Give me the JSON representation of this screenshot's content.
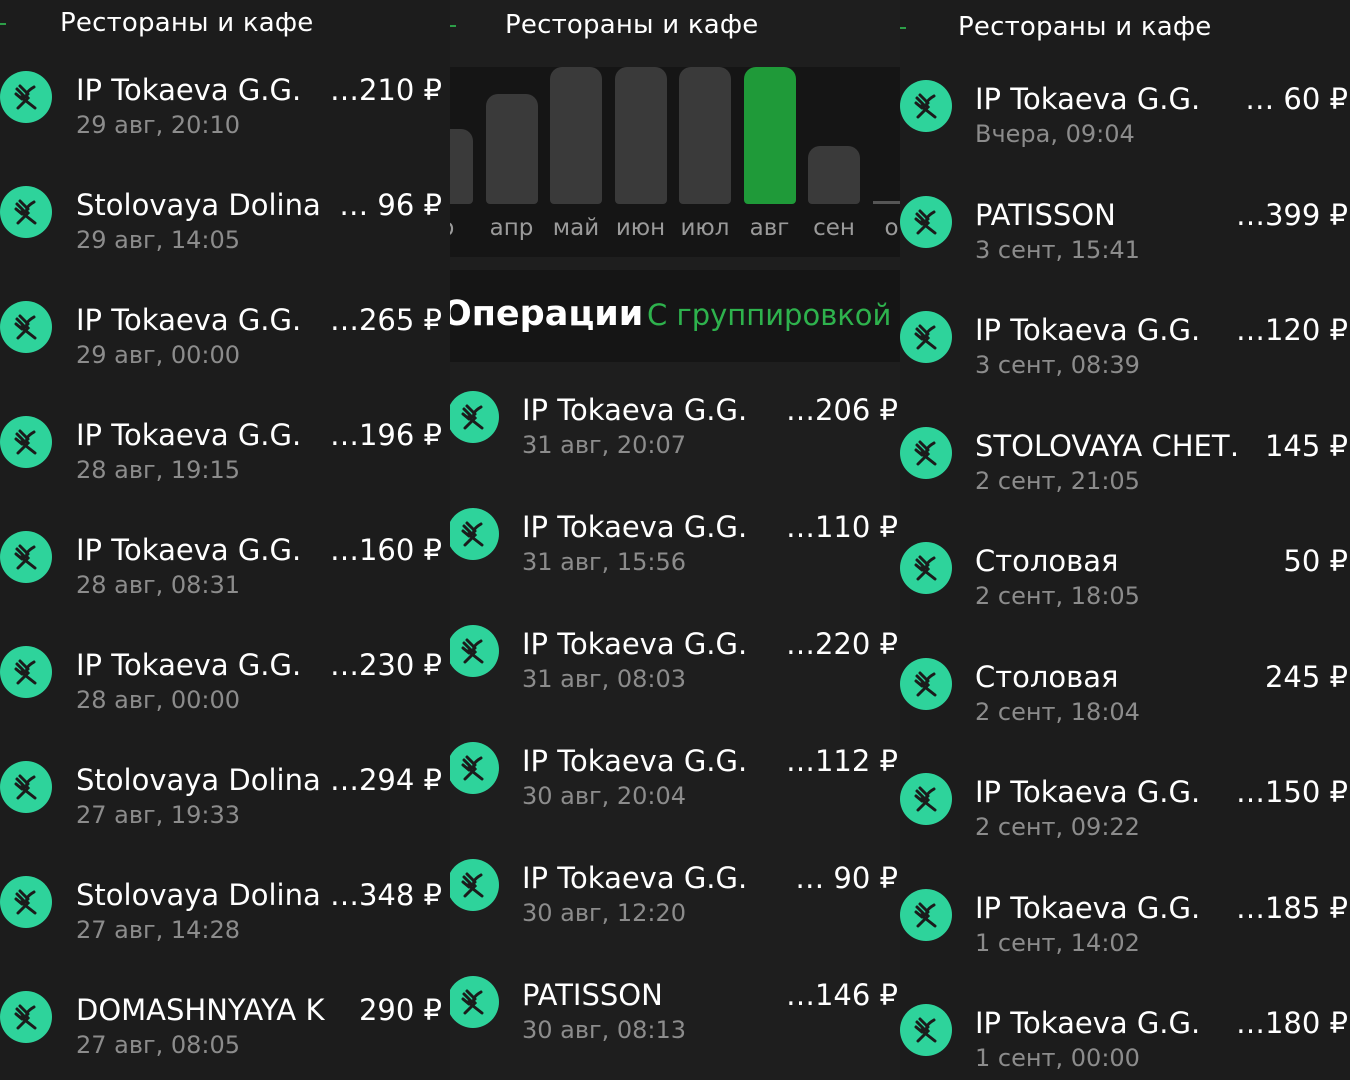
{
  "colors": {
    "icon_bg": "#2ed39b",
    "accent_green": "#1f9a39",
    "link_green": "#2eb24d",
    "date_gray": "#8c8c8c"
  },
  "icon": "fork-knife-icon",
  "panel1": {
    "title": "Рестораны и кафе",
    "transactions": [
      {
        "name": "IP Tokaeva G.G.",
        "amount": "…210 ₽",
        "date": "29 авг, 20:10"
      },
      {
        "name": "Stolovaya Dolina",
        "amount": "… 96 ₽",
        "date": "29 авг, 14:05"
      },
      {
        "name": "IP Tokaeva G.G.",
        "amount": "…265 ₽",
        "date": "29 авг, 00:00"
      },
      {
        "name": "IP Tokaeva G.G.",
        "amount": "…196 ₽",
        "date": "28 авг, 19:15"
      },
      {
        "name": "IP Tokaeva G.G.",
        "amount": "…160 ₽",
        "date": "28 авг, 08:31"
      },
      {
        "name": "IP Tokaeva G.G.",
        "amount": "…230 ₽",
        "date": "28 авг, 00:00"
      },
      {
        "name": "Stolovaya Dolina",
        "amount": "…294 ₽",
        "date": "27 авг, 19:33"
      },
      {
        "name": "Stolovaya Dolina",
        "amount": "…348 ₽",
        "date": "27 авг, 14:28"
      },
      {
        "name": "DOMASHNYAYA K…",
        "amount": "290 ₽",
        "date": "27 авг, 08:05"
      }
    ]
  },
  "panel2": {
    "title": "Рестораны и кафе",
    "chart": {
      "months": [
        "р",
        "апр",
        "май",
        "июн",
        "июл",
        "авг",
        "сен",
        "ок"
      ],
      "selected": "авг",
      "levels": [
        0.55,
        0.8,
        1.0,
        1.0,
        1.0,
        1.0,
        0.42,
        0.02
      ]
    },
    "operations_title": "Операции",
    "grouping_link": "С группировкой",
    "transactions": [
      {
        "name": "IP Tokaeva G.G.",
        "amount": "…206 ₽",
        "date": "31 авг, 20:07"
      },
      {
        "name": "IP Tokaeva G.G.",
        "amount": "…110 ₽",
        "date": "31 авг, 15:56"
      },
      {
        "name": "IP Tokaeva G.G.",
        "amount": "…220 ₽",
        "date": "31 авг, 08:03"
      },
      {
        "name": "IP Tokaeva G.G.",
        "amount": "…112 ₽",
        "date": "30 авг, 20:04"
      },
      {
        "name": "IP Tokaeva G.G.",
        "amount": "… 90 ₽",
        "date": "30 авг, 12:20"
      },
      {
        "name": "PATISSON",
        "amount": "…146 ₽",
        "date": "30 авг, 08:13"
      }
    ]
  },
  "panel3": {
    "title": "Рестораны и кафе",
    "transactions": [
      {
        "name": "IP Tokaeva G.G.",
        "amount": "… 60 ₽",
        "date": "Вчера, 09:04"
      },
      {
        "name": "PATISSON",
        "amount": "…399 ₽",
        "date": "3 сент, 15:41"
      },
      {
        "name": "IP Tokaeva G.G.",
        "amount": "…120 ₽",
        "date": "3 сент, 08:39"
      },
      {
        "name": "STOLOVAYA CHET…",
        "amount": "145 ₽",
        "date": "2 сент, 21:05"
      },
      {
        "name": "Столовая",
        "amount": "50 ₽",
        "date": "2 сент, 18:05"
      },
      {
        "name": "Столовая",
        "amount": "245 ₽",
        "date": "2 сент, 18:04"
      },
      {
        "name": "IP Tokaeva G.G.",
        "amount": "…150 ₽",
        "date": "2 сент, 09:22"
      },
      {
        "name": "IP Tokaeva G.G.",
        "amount": "…185 ₽",
        "date": "1 сент, 14:02"
      },
      {
        "name": "IP Tokaeva G.G.",
        "amount": "…180 ₽",
        "date": "1 сент, 00:00"
      }
    ]
  }
}
